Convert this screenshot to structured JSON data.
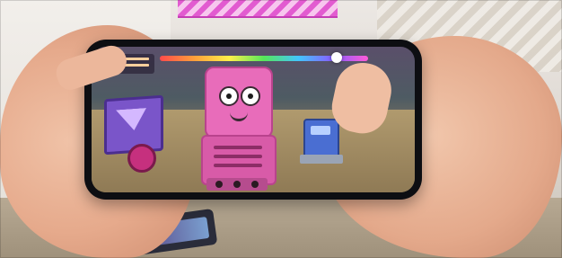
{
  "scene": {
    "description_visible_text": "",
    "colors": {
      "robot_pink": "#e86cba",
      "panel_purple": "#7a55c9",
      "bot_blue": "#4a6ed2",
      "card_zigzag": "#e25bd0"
    },
    "game_hud": {
      "health_bar_level": 0.85
    }
  }
}
